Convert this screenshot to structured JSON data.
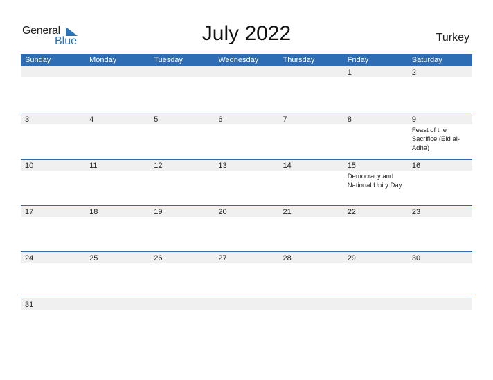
{
  "logo": {
    "general": "General",
    "blue": "Blue",
    "brand_color": "#2a74b8"
  },
  "title": "July 2022",
  "country": "Turkey",
  "header_color": "#2e6db4",
  "weekdays": [
    "Sunday",
    "Monday",
    "Tuesday",
    "Wednesday",
    "Thursday",
    "Friday",
    "Saturday"
  ],
  "weeks": [
    [
      {
        "d": ""
      },
      {
        "d": ""
      },
      {
        "d": ""
      },
      {
        "d": ""
      },
      {
        "d": ""
      },
      {
        "d": "1"
      },
      {
        "d": "2"
      }
    ],
    [
      {
        "d": "3"
      },
      {
        "d": "4"
      },
      {
        "d": "5"
      },
      {
        "d": "6"
      },
      {
        "d": "7"
      },
      {
        "d": "8"
      },
      {
        "d": "9",
        "event": "Feast of the Sacrifice (Eid al-Adha)"
      }
    ],
    [
      {
        "d": "10"
      },
      {
        "d": "11"
      },
      {
        "d": "12"
      },
      {
        "d": "13"
      },
      {
        "d": "14"
      },
      {
        "d": "15",
        "event": "Democracy and National Unity Day"
      },
      {
        "d": "16"
      }
    ],
    [
      {
        "d": "17"
      },
      {
        "d": "18"
      },
      {
        "d": "19"
      },
      {
        "d": "20"
      },
      {
        "d": "21"
      },
      {
        "d": "22"
      },
      {
        "d": "23"
      }
    ],
    [
      {
        "d": "24"
      },
      {
        "d": "25"
      },
      {
        "d": "26"
      },
      {
        "d": "27"
      },
      {
        "d": "28"
      },
      {
        "d": "29"
      },
      {
        "d": "30"
      }
    ],
    [
      {
        "d": "31"
      },
      {
        "d": ""
      },
      {
        "d": ""
      },
      {
        "d": ""
      },
      {
        "d": ""
      },
      {
        "d": ""
      },
      {
        "d": ""
      }
    ]
  ]
}
